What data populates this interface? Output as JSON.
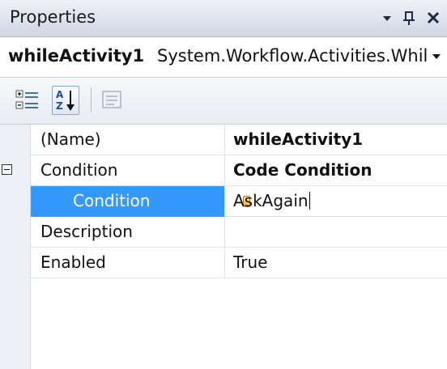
{
  "window": {
    "title": "Properties",
    "buttons": {
      "dropdown_glyph": "▾",
      "pin_glyph": "ꟻ",
      "close_glyph": "✕"
    }
  },
  "object_selector": {
    "name": "whileActivity1",
    "type": "System.Workflow.Activities.Whil",
    "arrow": "▾"
  },
  "toolbar": {
    "buttons": [
      {
        "name": "categorized-icon",
        "active": false
      },
      {
        "name": "sort-alphabetical-icon",
        "active": true
      },
      {
        "name": "property-pages-icon",
        "active": false,
        "disabled": true
      }
    ]
  },
  "grid": {
    "rows": [
      {
        "label": "(Name)",
        "value": "whileActivity1",
        "value_bold": true
      },
      {
        "label": "Condition",
        "value": "Code Condition",
        "value_bold": true,
        "expander": "expanded"
      },
      {
        "label": "Condition",
        "value": "AskAgain",
        "selected": true,
        "editing": true
      },
      {
        "label": "Description",
        "value": ""
      },
      {
        "label": "Enabled",
        "value": "True"
      }
    ]
  },
  "colors": {
    "selection": "#3399ff",
    "gutter": "#edf0f5",
    "titlebar": "#dde3ec"
  }
}
